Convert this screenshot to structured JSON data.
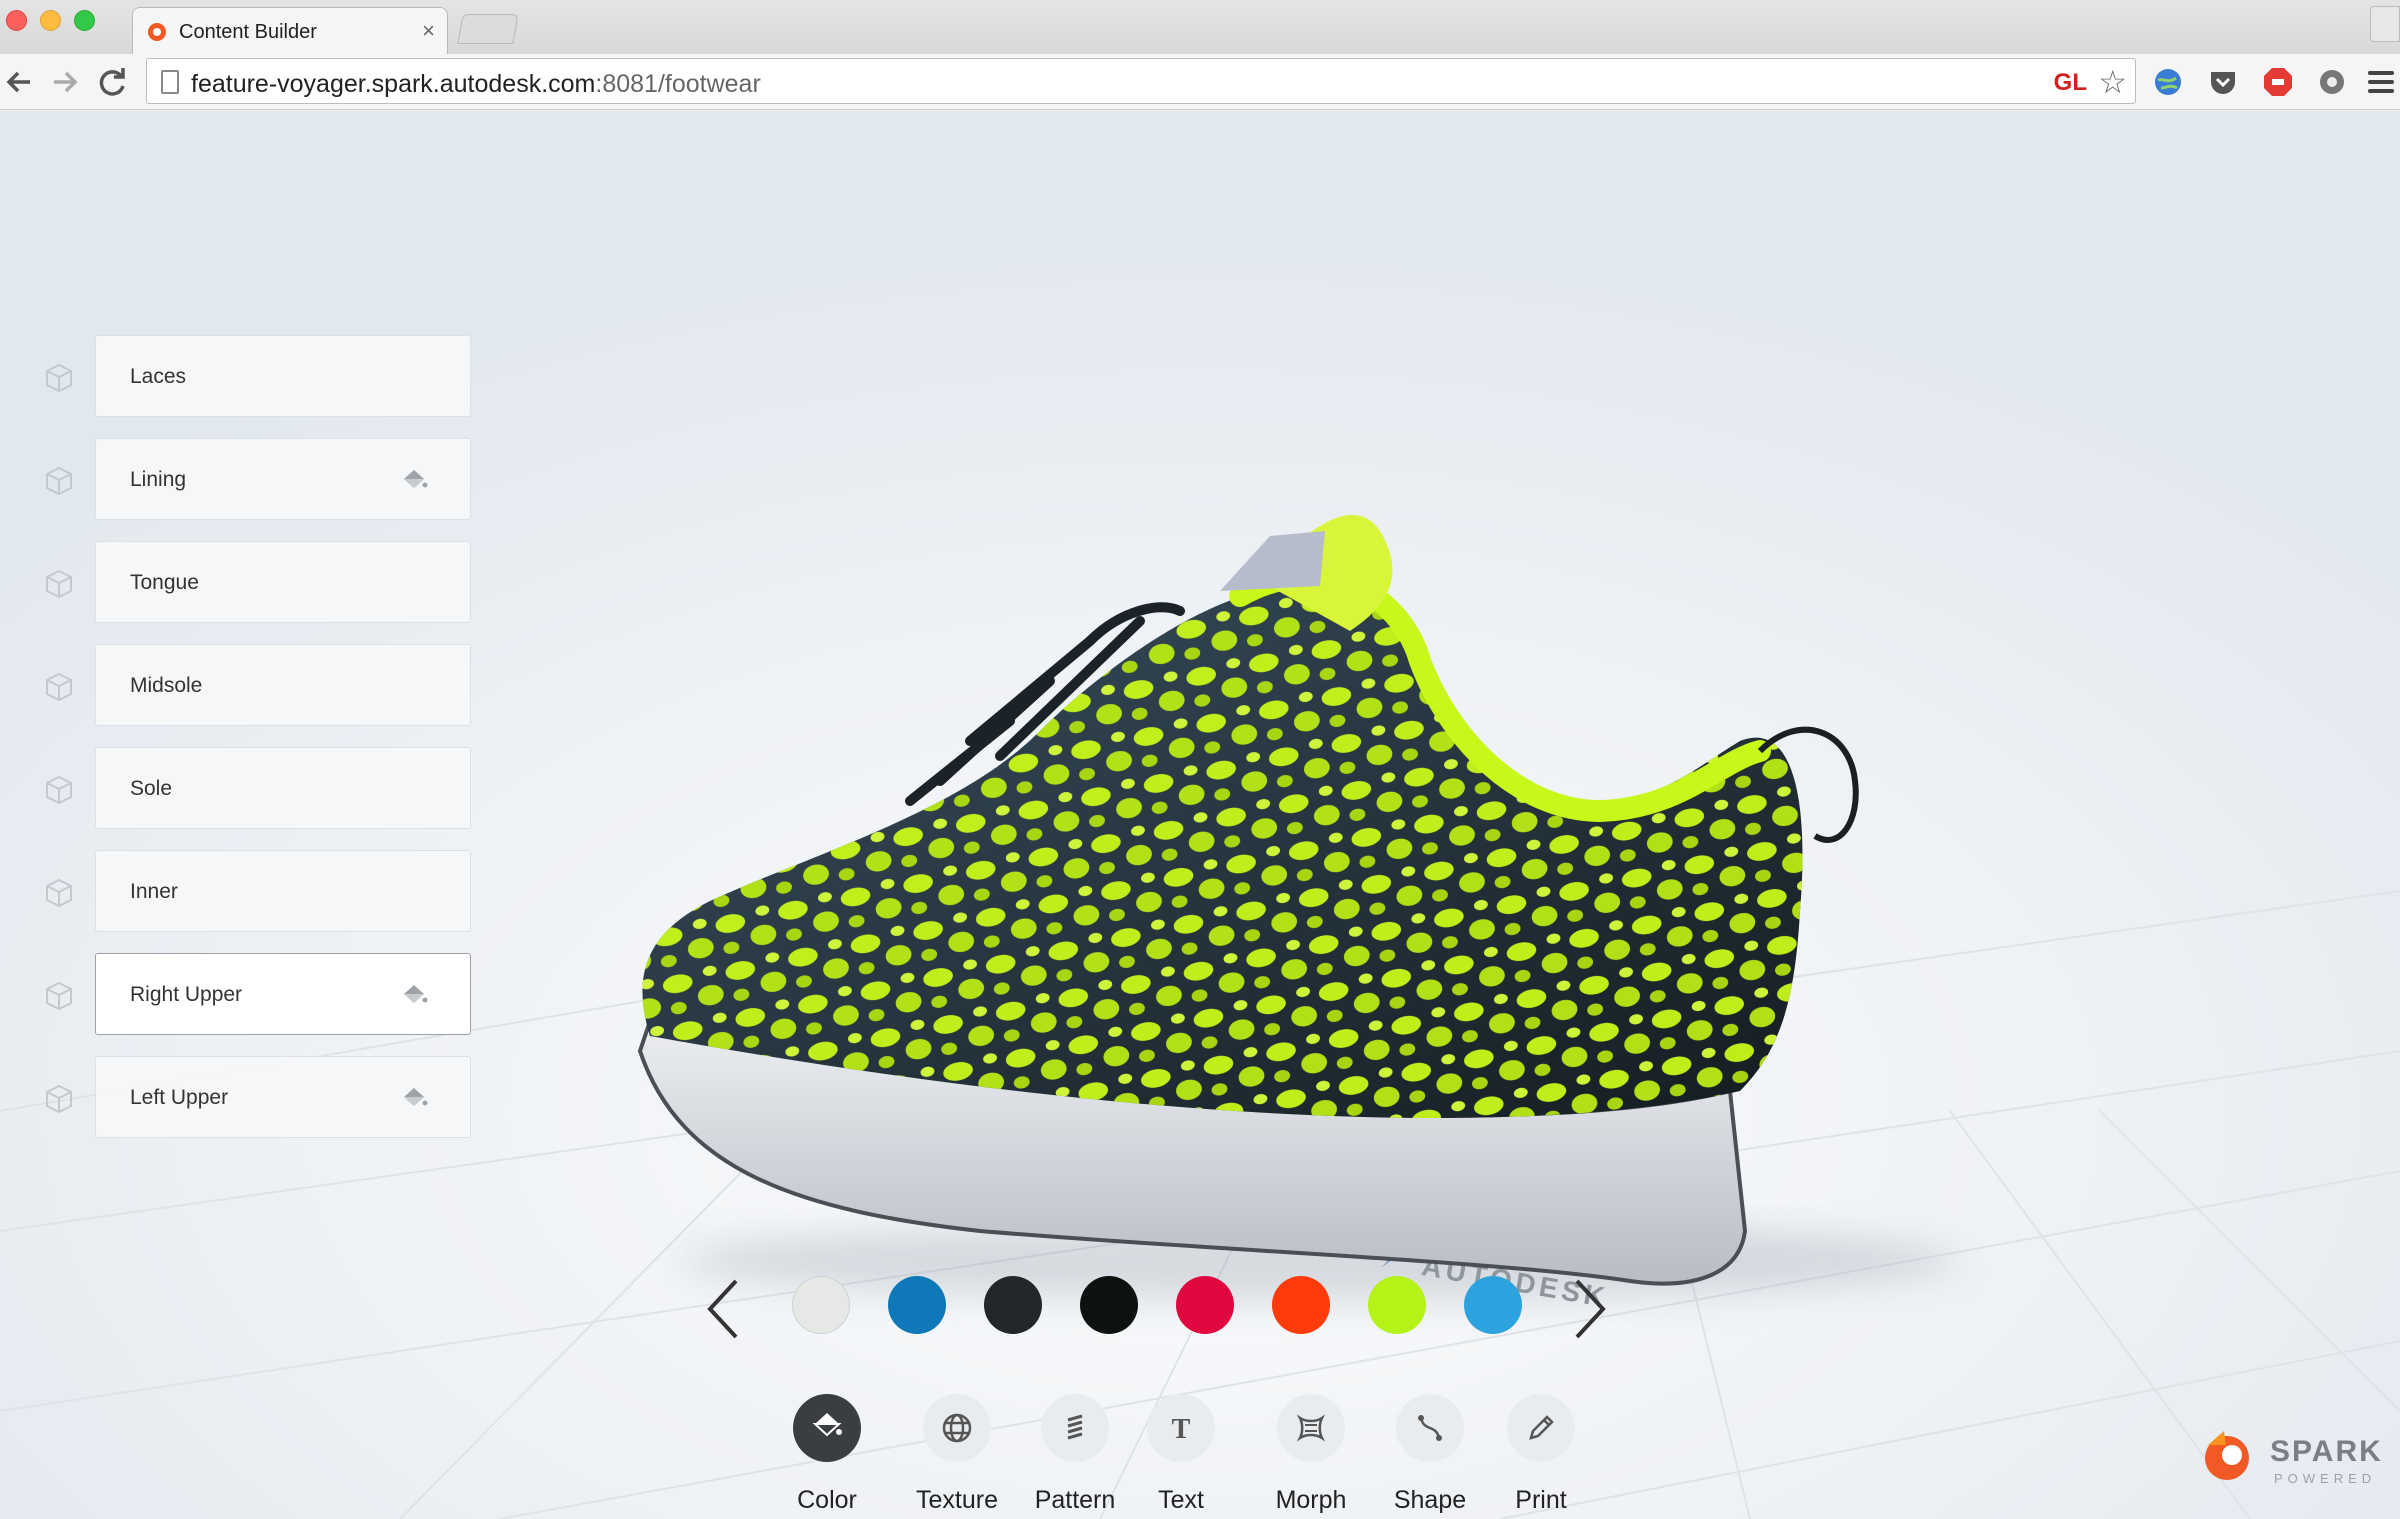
{
  "browser": {
    "tab_title": "Content Builder",
    "tab_close": "×",
    "url_host": "feature-voyager.spark.autodesk.com",
    "url_rest": ":8081/footwear",
    "badge_text": "GL"
  },
  "parts": [
    {
      "label": "Laces",
      "paint": false,
      "active": false
    },
    {
      "label": "Lining",
      "paint": true,
      "active": false
    },
    {
      "label": "Tongue",
      "paint": false,
      "active": false
    },
    {
      "label": "Midsole",
      "paint": false,
      "active": false
    },
    {
      "label": "Sole",
      "paint": false,
      "active": false
    },
    {
      "label": "Inner",
      "paint": false,
      "active": false
    },
    {
      "label": "Right Upper",
      "paint": true,
      "active": true
    },
    {
      "label": "Left Upper",
      "paint": true,
      "active": false
    }
  ],
  "swatches": [
    "#e6e8e5",
    "#0e78b9",
    "#23262a",
    "#0d1110",
    "#e1083f",
    "#ff3a0b",
    "#b4f218",
    "#2ca3df"
  ],
  "tools": [
    {
      "label": "Color",
      "icon": "paint-bucket-icon",
      "active": true
    },
    {
      "label": "Texture",
      "icon": "globe-grid-icon",
      "active": false
    },
    {
      "label": "Pattern",
      "icon": "pattern-stripes-icon",
      "active": false
    },
    {
      "label": "Text",
      "icon": "text-t-icon",
      "active": false
    },
    {
      "label": "Morph",
      "icon": "morph-icon",
      "active": false
    },
    {
      "label": "Shape",
      "icon": "shape-curve-icon",
      "active": false
    },
    {
      "label": "Print",
      "icon": "pencil-icon",
      "active": false
    }
  ],
  "branding": {
    "floor_logo": "AUTODESK",
    "spark_word": "SPARK",
    "spark_sub": "POWERED"
  },
  "colors": {
    "accent_lime": "#c8f81a",
    "shoe_dark": "#1f2a30",
    "sole": "#d4d6dc"
  }
}
